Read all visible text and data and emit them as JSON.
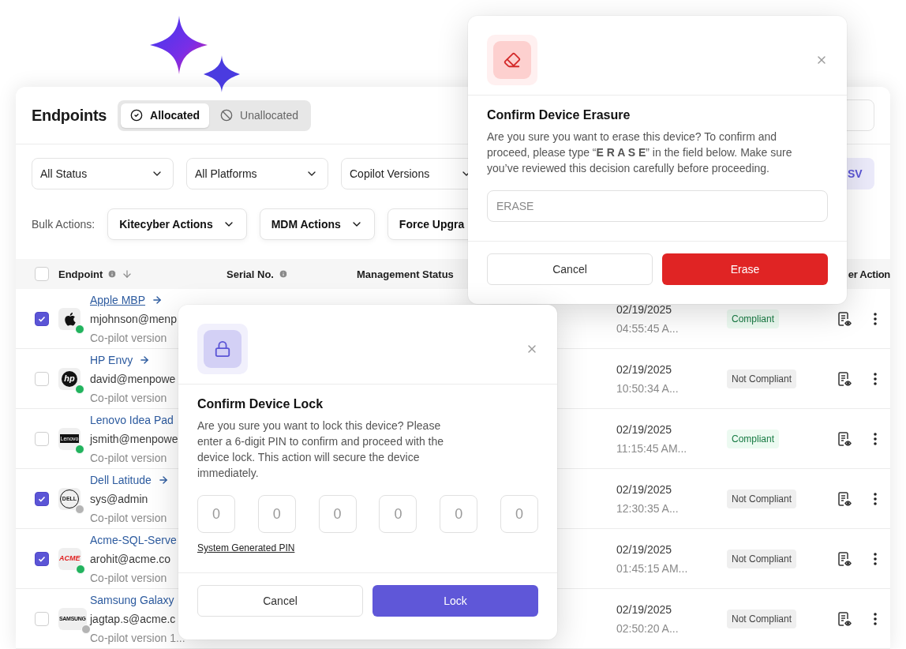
{
  "header": {
    "title": "Endpoints",
    "tabs": [
      {
        "label": "Allocated",
        "selected": true,
        "kind": "check"
      },
      {
        "label": "Unallocated",
        "selected": false,
        "kind": "ban"
      }
    ]
  },
  "filters": [
    {
      "label": "All Status"
    },
    {
      "label": "All Platforms"
    },
    {
      "label": "Copilot Versions"
    }
  ],
  "export_button": "SV",
  "bulk": {
    "label": "Bulk Actions:",
    "actions": [
      {
        "label": "Kitecyber Actions",
        "caret": true
      },
      {
        "label": "MDM Actions",
        "caret": true
      },
      {
        "label": "Force Upgra",
        "caret": false
      }
    ]
  },
  "table": {
    "select_all": {
      "checked": false
    },
    "columns": [
      {
        "label": "Endpoint",
        "kind": "info_sort"
      },
      {
        "label": "Serial No.",
        "kind": "info"
      },
      {
        "label": "Management Status",
        "kind": "plain"
      },
      {
        "label": "er Action"
      }
    ],
    "rows": [
      {
        "selected": true,
        "logo": {
          "kind": "apple"
        },
        "color": "#22b35e",
        "name": "Apple MBP",
        "arrow": true,
        "hovered": true,
        "email": "mjohnson@menp",
        "version": "Co-pilot version",
        "date": "02/19/2025",
        "time": "04:55:45 A...",
        "compliance": {
          "kind": "good",
          "label": "Compliant"
        }
      },
      {
        "selected": false,
        "logo": {
          "kind": "hp",
          "text": "hp"
        },
        "color": "#22b35e",
        "name": "HP Envy",
        "arrow": true,
        "hovered": false,
        "email": "david@menpowe",
        "version": "Co-pilot version",
        "date": "02/19/2025",
        "time": "10:50:34 A...",
        "compliance": {
          "kind": "bad",
          "label": "Not Compliant"
        }
      },
      {
        "selected": false,
        "logo": {
          "kind": "bar",
          "text": "Lenovo"
        },
        "color": "#22b35e",
        "name": "Lenovo Idea Pad",
        "arrow": false,
        "hovered": false,
        "email": "jsmith@menpowe",
        "version": "Co-pilot version",
        "date": "02/19/2025",
        "time": "11:15:45 AM...",
        "compliance": {
          "kind": "good",
          "label": "Compliant"
        }
      },
      {
        "selected": true,
        "logo": {
          "kind": "ring",
          "text": "DELL"
        },
        "color": "#b4b4b4",
        "name": "Dell Latitude",
        "arrow": true,
        "hovered": false,
        "email": "sys@admin",
        "version": "Co-pilot version",
        "date": "02/19/2025",
        "time": "12:30:35 A...",
        "compliance": {
          "kind": "bad",
          "label": "Not Compliant"
        }
      },
      {
        "selected": true,
        "logo": {
          "kind": "red",
          "text": "ACME"
        },
        "color": "#22b35e",
        "name": "Acme-SQL-Serve",
        "arrow": false,
        "hovered": false,
        "email": "arohit@acme.co",
        "version": "Co-pilot version",
        "date": "02/19/2025",
        "time": "01:45:15 AM...",
        "compliance": {
          "kind": "bad",
          "label": "Not Compliant"
        }
      },
      {
        "selected": false,
        "logo": {
          "kind": "small",
          "text": "SAMSUNG"
        },
        "color": "#b4b4b4",
        "name": "Samsung Galaxy",
        "arrow": false,
        "hovered": false,
        "email": "jagtap.s@acme.c",
        "version": "Co-pilot version 1...",
        "date": "02/19/2025",
        "time": "02:50:20 A...",
        "compliance": {
          "kind": "bad",
          "label": "Not Compliant"
        }
      }
    ]
  },
  "erase_dialog": {
    "title": "Confirm Device Erasure",
    "text": "Are you sure you want to erase this device? To confirm and proceed, please type “**E R A S E**” in the field below. Make sure you’ve reviewed this decision carefully before proceeding.",
    "placeholder": "ERASE",
    "cancel": "Cancel",
    "confirm": "Erase"
  },
  "lock_dialog": {
    "title": "Confirm Device Lock",
    "text": "Are you sure you want to lock this device? Please enter a 6-digit PIN to confirm and proceed with the device lock. This action will secure the device immediately.",
    "pins": [
      {
        "placeholder": "0"
      },
      {
        "placeholder": "0"
      },
      {
        "placeholder": "0"
      },
      {
        "placeholder": "0"
      },
      {
        "placeholder": "0"
      },
      {
        "placeholder": "0"
      }
    ],
    "link": "System Generated PIN",
    "cancel": "Cancel",
    "confirm": "Lock"
  }
}
